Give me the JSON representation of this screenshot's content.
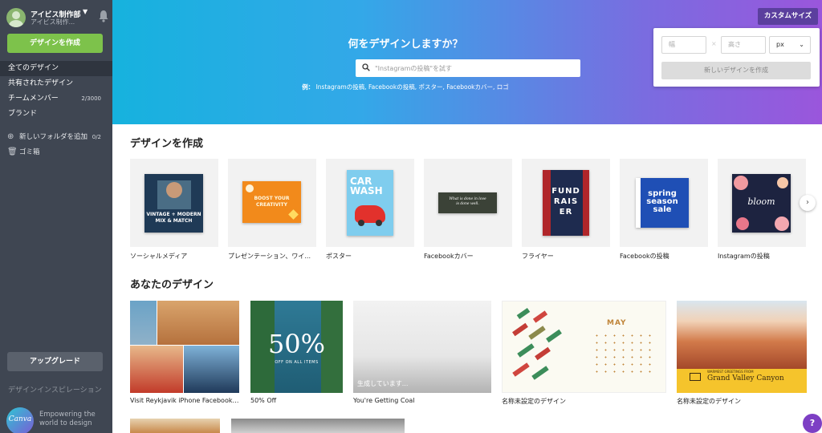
{
  "team": {
    "name": "アイビス制作部",
    "subtitle": "アイビス制作..."
  },
  "sidebar": {
    "create_label": "デザインを作成",
    "nav": [
      {
        "label": "全てのデザイン",
        "count": ""
      },
      {
        "label": "共有されたデザイン",
        "count": ""
      },
      {
        "label": "チームメンバー",
        "count": "2/3000"
      },
      {
        "label": "ブランド",
        "count": ""
      }
    ],
    "add_folder_label": "新しいフォルダを追加",
    "add_folder_count": "0/2",
    "trash_label": "ゴミ箱",
    "upgrade_label": "アップグレード",
    "inspiration_label": "デザインインスピレーション",
    "logo_text": "Canva",
    "tagline": "Empowering the world to design"
  },
  "hero": {
    "title": "何をデザインしますか？",
    "search_placeholder": "\"Instagramの投稿\"を試す",
    "examples_prefix": "例：",
    "examples": "Instagramの投稿, Facebookの投稿, ポスター, Facebookカバー, ロゴ"
  },
  "custom_size": {
    "button_label": "カスタムサイズ",
    "width_placeholder": "幅",
    "height_placeholder": "高さ",
    "times": "×",
    "unit": "px",
    "create_label": "新しいデザインを作成"
  },
  "create_section": {
    "title": "デザインを作成",
    "templates": [
      {
        "label": "ソーシャルメディア",
        "thumb_lines": [
          "VINTAGE + MODERN",
          "MIX & MATCH"
        ]
      },
      {
        "label": "プレゼンテーション、ワイ...",
        "thumb_lines": [
          "BOOST YOUR",
          "CREATIVITY"
        ]
      },
      {
        "label": "ポスター",
        "thumb_lines": [
          "CAR",
          "WASH"
        ]
      },
      {
        "label": "Facebookカバー",
        "thumb_lines": [
          "What is done in love",
          "is done well."
        ]
      },
      {
        "label": "フライヤー",
        "thumb_lines": [
          "FUND",
          "RAIS",
          "ER"
        ]
      },
      {
        "label": "Facebookの投稿",
        "thumb_lines": [
          "spring",
          "season",
          "sale"
        ]
      },
      {
        "label": "Instagramの投稿",
        "thumb_lines": [
          "bloom"
        ]
      }
    ]
  },
  "your_designs": {
    "title": "あなたのデザイン",
    "items": [
      {
        "label": "Visit Reykjavik iPhone Facebook P...",
        "overlay": ""
      },
      {
        "label": "50% Off",
        "overlay": "50%",
        "overlay_sub": "OFF ON ALL ITEMS"
      },
      {
        "label": "You're Getting Coal",
        "overlay": "生成しています..."
      },
      {
        "label": "名称未設定のデザイン",
        "overlay": "MAY"
      },
      {
        "label": "名称未設定のデザイン",
        "overlay": "Grand Valley Canyon",
        "overlay_sub": "WARMEST GREETINGS FROM"
      }
    ]
  },
  "help_label": "?"
}
